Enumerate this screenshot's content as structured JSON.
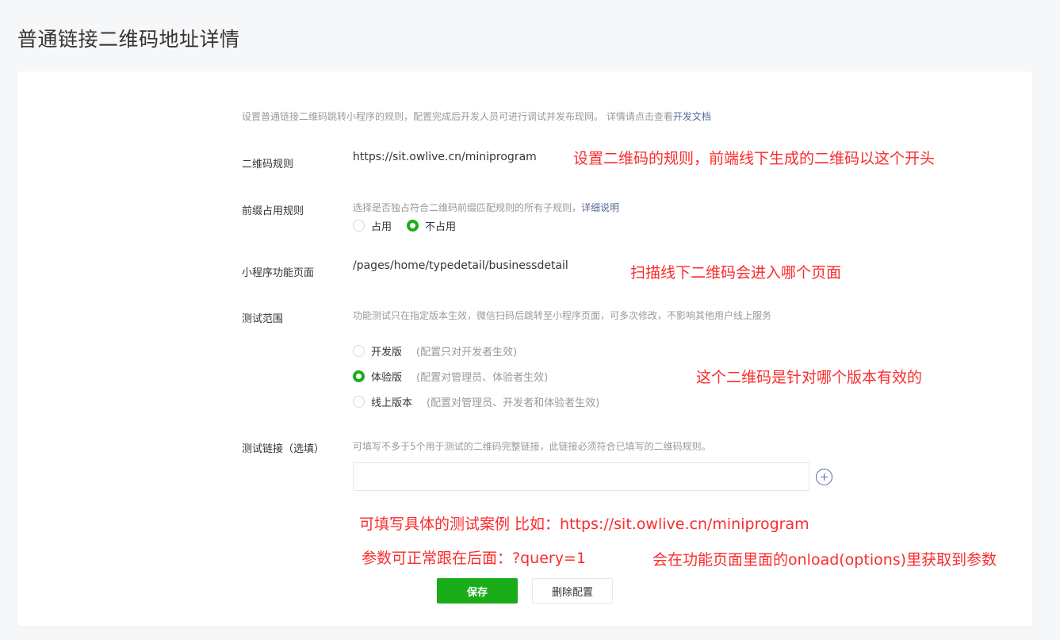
{
  "page": {
    "title": "普通链接二维码地址详情"
  },
  "intro": {
    "text": "设置普通链接二维码跳转小程序的规则，配置完成后开发人员可进行调试并发布现网。 详情请点击查看",
    "link": "开发文档"
  },
  "rule": {
    "label": "二维码规则",
    "value": "https://sit.owlive.cn/miniprogram",
    "annotation": "设置二维码的规则，前端线下生成的二维码以这个开头"
  },
  "prefix": {
    "label": "前缀占用规则",
    "desc": "选择是否独占符合二维码前缀匹配规则的所有子规则，",
    "link": "详细说明",
    "options": [
      {
        "label": "占用",
        "selected": false
      },
      {
        "label": "不占用",
        "selected": true
      }
    ]
  },
  "page_path": {
    "label": "小程序功能页面",
    "value": "/pages/home/typedetail/businessdetail",
    "annotation": "扫描线下二维码会进入哪个页面"
  },
  "test_scope": {
    "label": "测试范围",
    "desc": "功能测试只在指定版本生效，微信扫码后跳转至小程序页面，可多次修改，不影响其他用户线上服务",
    "options": [
      {
        "label": "开发版",
        "hint": "(配置只对开发者生效)",
        "selected": false
      },
      {
        "label": "体验版",
        "hint": "(配置对管理员、体验者生效)",
        "selected": true
      },
      {
        "label": "线上版本",
        "hint": "(配置对管理员、开发者和体验者生效)",
        "selected": false
      }
    ],
    "annotation": "这个二维码是针对哪个版本有效的"
  },
  "test_links": {
    "label": "测试链接（选填）",
    "desc": "可填写不多于5个用于测试的二维码完整链接，此链接必须符合已填写的二维码规则。",
    "value": "",
    "annotation1": "可填写具体的测试案例  比如：https://sit.owlive.cn/miniprogram",
    "annotation2": "参数可正常跟在后面：?query=1",
    "annotation3": "会在功能页面里面的onload(options)里获取到参数"
  },
  "actions": {
    "save": "保存",
    "delete": "删除配置"
  },
  "colors": {
    "primary": "#1aad19",
    "link": "#576b95",
    "annotation": "#fa2c2c"
  },
  "icons": {
    "add": "plus-circle-icon"
  }
}
